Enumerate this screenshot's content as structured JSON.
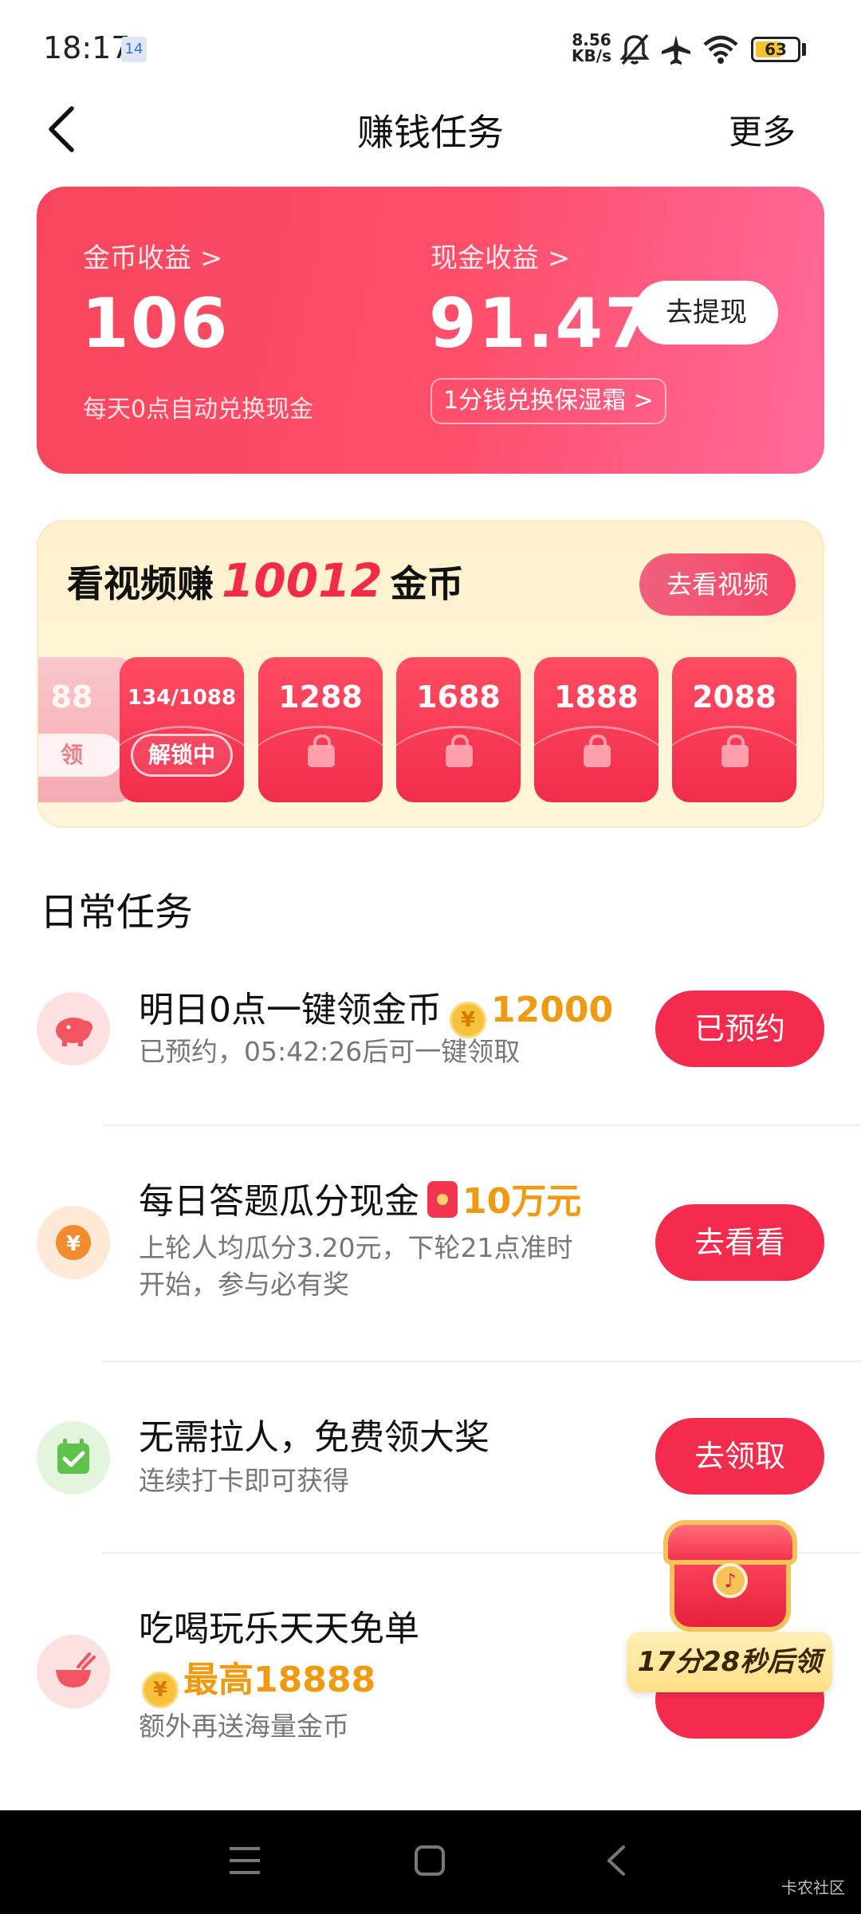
{
  "status_bar": {
    "time": "18:17",
    "notif_badge": "14",
    "net_speed_value": "8.56",
    "net_speed_unit": "KB/s",
    "battery_level": 63,
    "battery_text": "63"
  },
  "nav": {
    "title": "赚钱任务",
    "more": "更多"
  },
  "earnings": {
    "coin_label": "金币收益 >",
    "coin_value": "106",
    "coin_note": "每天0点自动兑换现金",
    "cash_label": "现金收益 >",
    "cash_value": "91.47",
    "withdraw_button": "去提现",
    "exchange_chip": "1分钱兑换保湿霜 >"
  },
  "video": {
    "title_prefix": "看视频赚",
    "title_number": "10012",
    "title_suffix": "金币",
    "watch_button": "去看视频",
    "envelopes": [
      {
        "amount": "88",
        "tag": "领",
        "state": "claimed"
      },
      {
        "amount": "134/1088",
        "tag": "解锁中",
        "state": "unlocking"
      },
      {
        "amount": "1288",
        "state": "locked"
      },
      {
        "amount": "1688",
        "state": "locked"
      },
      {
        "amount": "1888",
        "state": "locked"
      },
      {
        "amount": "2088",
        "state": "locked"
      }
    ]
  },
  "daily": {
    "section_title": "日常任务",
    "tasks": [
      {
        "title": "明日0点一键领金币",
        "reward": "12000",
        "subtitle": "已预约，05:42:26后可一键领取",
        "button": "已预约",
        "icon": "piggy-bank-icon",
        "icon_color": "#fde1e1"
      },
      {
        "title": "每日答题瓜分现金",
        "reward": "10万元",
        "subtitle_line1": "上轮人均瓜分3.20元，下轮21点准时",
        "subtitle_line2": "开始，参与必有奖",
        "button": "去看看",
        "icon": "yuan-coin-icon",
        "icon_color": "#fde9d6"
      },
      {
        "title": "无需拉人，免费领大奖",
        "subtitle": "连续打卡即可获得",
        "button": "去领取",
        "icon": "calendar-check-icon",
        "icon_color": "#e3f6dd"
      },
      {
        "title": "吃喝玩乐天天免单",
        "reward": "最高18888",
        "subtitle": "额外再送海量金币",
        "icon": "bowl-icon",
        "icon_color": "#fde1e1"
      }
    ]
  },
  "floating_chest": {
    "timer": "17分28秒后领"
  },
  "watermark": "卡农社区",
  "colors": {
    "accent": "#f42b4c",
    "reward": "#ef9a10"
  }
}
